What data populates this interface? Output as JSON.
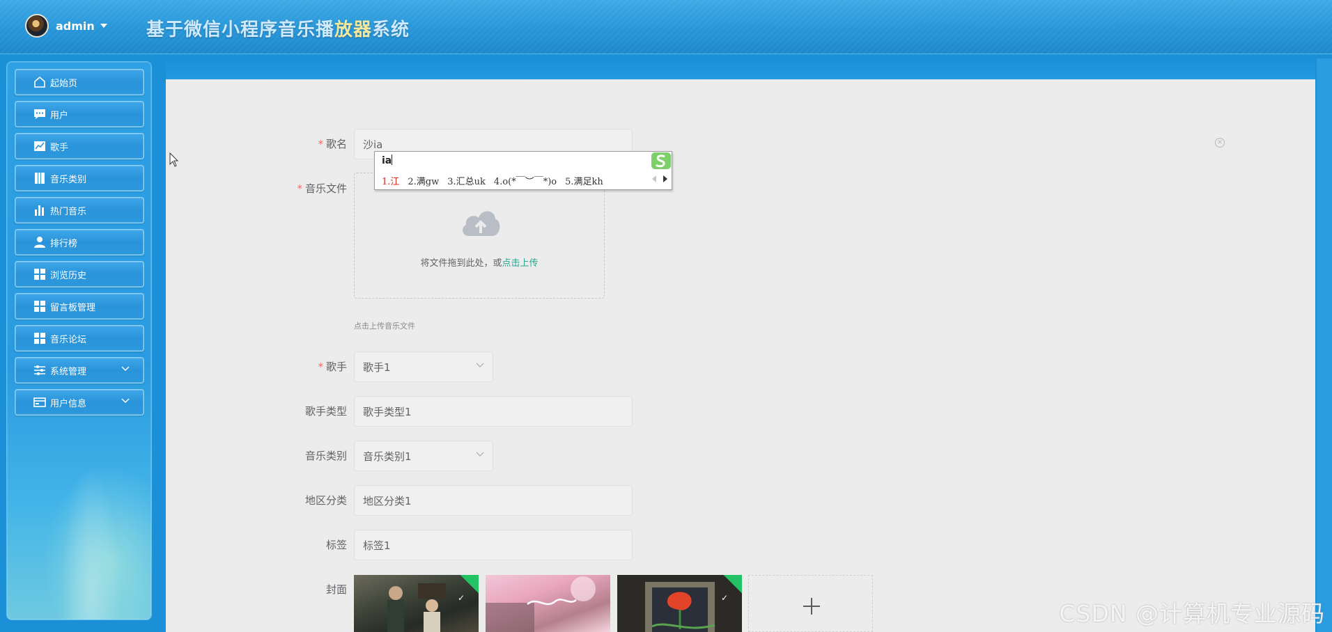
{
  "header": {
    "username": "admin",
    "title_main": "基于微信小程序音乐播",
    "title_highlight": "放器",
    "title_tail": "系统"
  },
  "sidebar": {
    "items": [
      {
        "label": "起始页",
        "icon": "home-icon"
      },
      {
        "label": "用户",
        "icon": "chat-icon"
      },
      {
        "label": "歌手",
        "icon": "chart-line-icon"
      },
      {
        "label": "音乐类别",
        "icon": "book-icon"
      },
      {
        "label": "热门音乐",
        "icon": "bar-chart-icon"
      },
      {
        "label": "排行榜",
        "icon": "person-icon"
      },
      {
        "label": "浏览历史",
        "icon": "grid-icon"
      },
      {
        "label": "留言板管理",
        "icon": "grid-icon"
      },
      {
        "label": "音乐论坛",
        "icon": "grid-icon"
      },
      {
        "label": "系统管理",
        "icon": "sliders-icon",
        "expandable": true
      },
      {
        "label": "用户信息",
        "icon": "card-icon",
        "expandable": true
      }
    ]
  },
  "form": {
    "song_name": {
      "label": "歌名",
      "value": "沙ia",
      "required": true
    },
    "music_file": {
      "label": "音乐文件",
      "required": true,
      "drop_text": "将文件拖到此处，或",
      "drop_link": "点击上传",
      "tip": "点击上传音乐文件"
    },
    "singer": {
      "label": "歌手",
      "value": "歌手1",
      "required": true
    },
    "singer_type": {
      "label": "歌手类型",
      "value": "歌手类型1"
    },
    "music_category": {
      "label": "音乐类别",
      "value": "音乐类别1"
    },
    "region": {
      "label": "地区分类",
      "value": "地区分类1"
    },
    "tags": {
      "label": "标签",
      "value": "标签1"
    },
    "cover": {
      "label": "封面"
    }
  },
  "ime": {
    "composition": "ia",
    "candidates": [
      "1.江",
      "2.满gw",
      "3.汇总uk",
      "4.o(*￣︶￣*)o",
      "5.满足kh"
    ]
  },
  "watermark": "CSDN @计算机专业源码",
  "colors": {
    "brand_blue": "#2796d8",
    "required_red": "#f56c6c",
    "link_green": "#2aa58e",
    "ime_first": "#d8251d"
  }
}
